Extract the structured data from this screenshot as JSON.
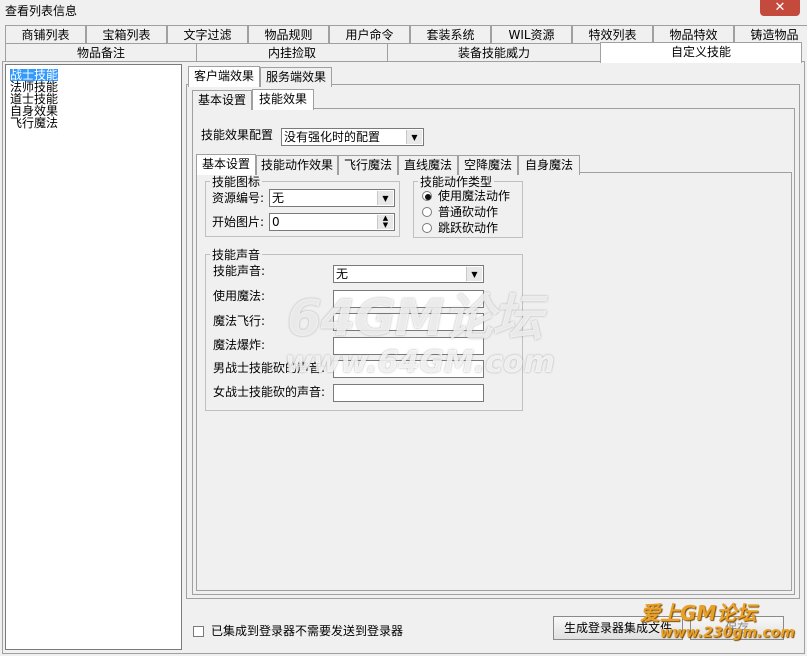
{
  "window": {
    "title": "查看列表信息",
    "close": "✕"
  },
  "top_tabs_row1": [
    "商铺列表",
    "宝箱列表",
    "文字过滤",
    "物品规则",
    "用户命令",
    "套装系统",
    "WIL资源",
    "特效列表",
    "物品特效",
    "铸造物品"
  ],
  "top_tabs_row2": [
    "物品备注",
    "内挂捡取",
    "装备技能威力",
    "自定义技能"
  ],
  "skill_list": [
    "战士技能",
    "法师技能",
    "道士技能",
    "自身效果",
    "飞行魔法"
  ],
  "effect_tabs": [
    "客户端效果",
    "服务端效果"
  ],
  "client_tabs": [
    "基本设置",
    "技能效果"
  ],
  "config": {
    "label": "技能效果配置",
    "value": "没有强化时的配置"
  },
  "effect_sub_tabs": [
    "基本设置",
    "技能动作效果",
    "飞行魔法",
    "直线魔法",
    "空降魔法",
    "自身魔法"
  ],
  "skill_icon": {
    "title": "技能图标",
    "resource_label": "资源编号:",
    "resource_value": "无",
    "start_label": "开始图片:",
    "start_value": "0"
  },
  "action_type": {
    "title": "技能动作类型",
    "options": [
      "使用魔法动作",
      "普通砍动作",
      "跳跃砍动作"
    ],
    "selected": 0
  },
  "sound": {
    "title": "技能声音",
    "skill_sound_label": "技能声音:",
    "skill_sound_value": "无",
    "use_label": "使用魔法:",
    "fly_label": "魔法飞行:",
    "explode_label": "魔法爆炸:",
    "male_label": "男战士技能砍的声音:",
    "female_label": "女战士技能砍的声音:"
  },
  "footer": {
    "checkbox_label": "已集成到登录器不需要发送到登录器",
    "generate_button": "生成登录器集成文件",
    "save_button": "保存"
  },
  "watermarks": {
    "main": "64GM论坛",
    "url": "www.64GM.com",
    "corner1": "爱上GM论坛",
    "corner2": "www.230gm.com"
  }
}
